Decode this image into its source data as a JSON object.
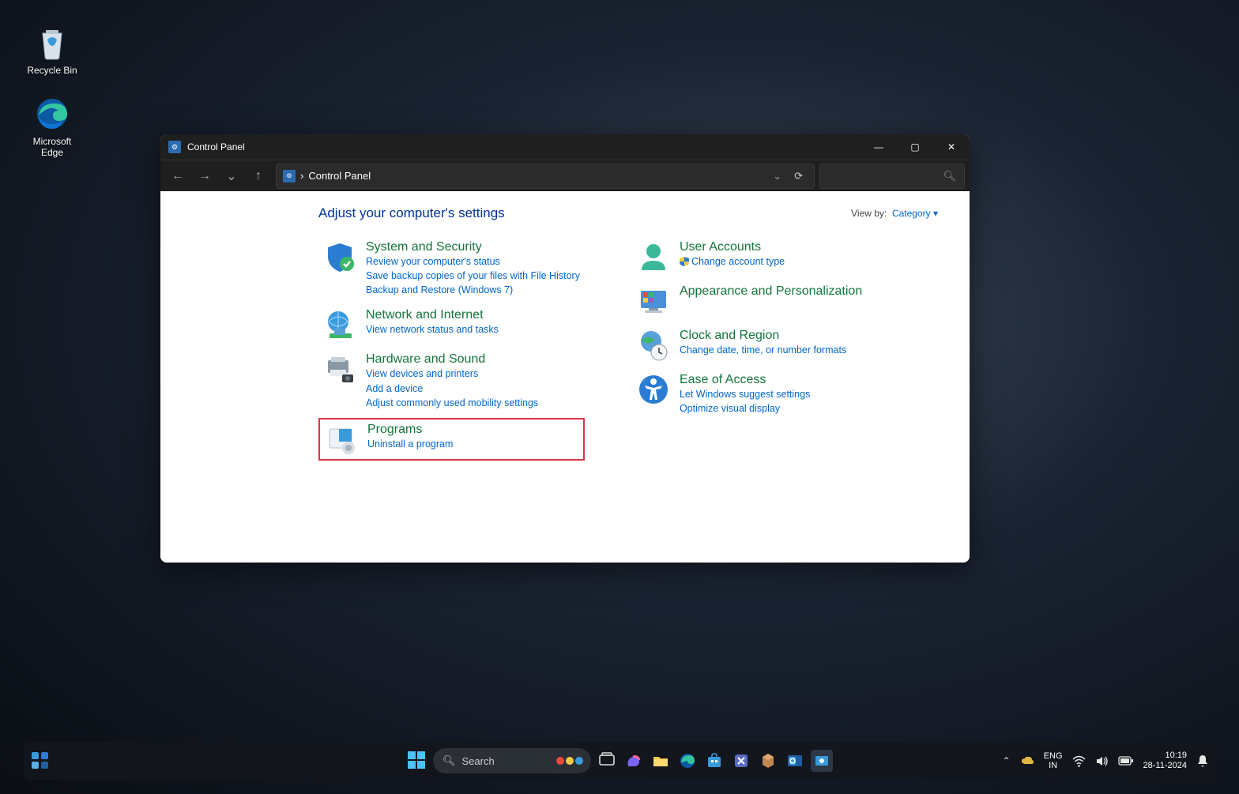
{
  "desktop": {
    "recycle_label": "Recycle Bin",
    "edge_label": "Microsoft Edge"
  },
  "window": {
    "title": "Control Panel",
    "breadcrumb_sep": "›",
    "breadcrumb_text": "Control Panel",
    "header": "Adjust your computer's settings",
    "viewby_label": "View by:",
    "viewby_value": "Category",
    "categories_left": [
      {
        "title": "System and Security",
        "links": [
          "Review your computer's status",
          "Save backup copies of your files with File History",
          "Backup and Restore (Windows 7)"
        ]
      },
      {
        "title": "Network and Internet",
        "links": [
          "View network status and tasks"
        ]
      },
      {
        "title": "Hardware and Sound",
        "links": [
          "View devices and printers",
          "Add a device",
          "Adjust commonly used mobility settings"
        ]
      },
      {
        "title": "Programs",
        "links": [
          "Uninstall a program"
        ],
        "highlight": true
      }
    ],
    "categories_right": [
      {
        "title": "User Accounts",
        "links": [
          "Change account type"
        ],
        "shield_on_first": true
      },
      {
        "title": "Appearance and Personalization",
        "links": []
      },
      {
        "title": "Clock and Region",
        "links": [
          "Change date, time, or number formats"
        ]
      },
      {
        "title": "Ease of Access",
        "links": [
          "Let Windows suggest settings",
          "Optimize visual display"
        ]
      }
    ]
  },
  "taskbar": {
    "search_placeholder": "Search",
    "lang_line1": "ENG",
    "lang_line2": "IN",
    "time": "10:19",
    "date": "28-11-2024"
  }
}
